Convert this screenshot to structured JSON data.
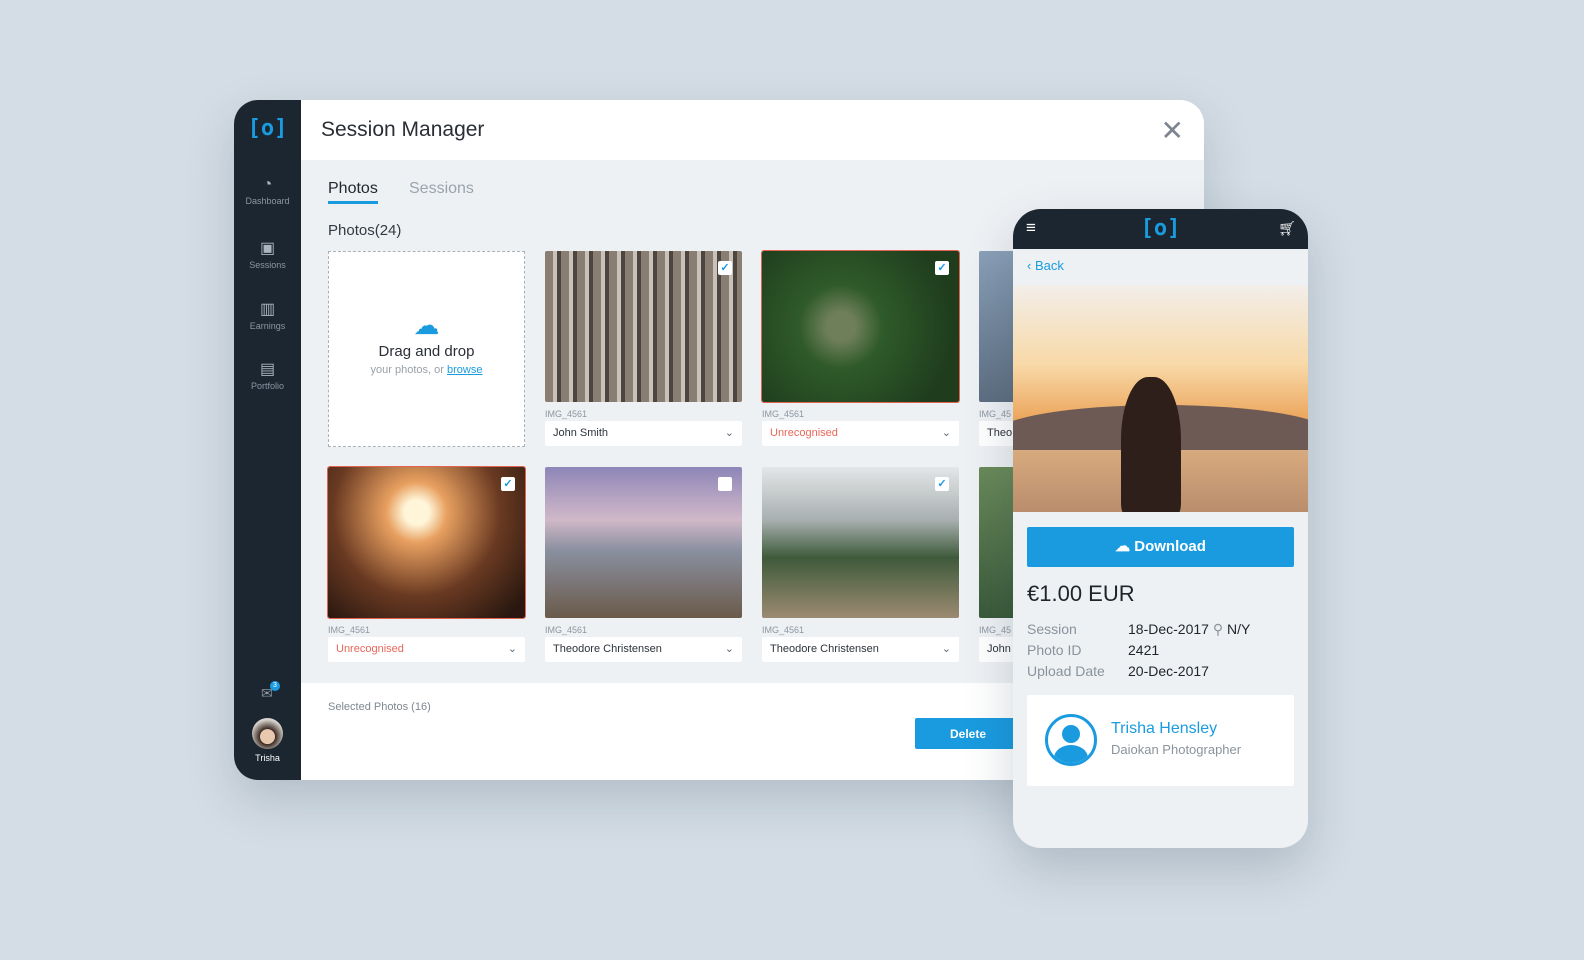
{
  "app": {
    "logo": "[o]",
    "title": "Session Manager",
    "close_icon": "close-icon"
  },
  "sidebar": {
    "items": [
      {
        "label": "Dashboard",
        "icon": "gauge-icon"
      },
      {
        "label": "Sessions",
        "icon": "camera-icon"
      },
      {
        "label": "Earnings",
        "icon": "bar-chart-icon"
      },
      {
        "label": "Portfolio",
        "icon": "briefcase-icon"
      }
    ],
    "messages_badge": "3",
    "user": "Trisha"
  },
  "tabs": [
    {
      "label": "Photos",
      "active": true
    },
    {
      "label": "Sessions",
      "active": false
    }
  ],
  "photos": {
    "heading": "Photos(24)",
    "upload": {
      "title": "Drag and drop",
      "sub": "your photos, or ",
      "link": "browse"
    },
    "items": [
      {
        "caption": "IMG_4561",
        "person": "John Smith",
        "checked": true,
        "unrecognised": false
      },
      {
        "caption": "IMG_4561",
        "person": "Unrecognised",
        "checked": true,
        "unrecognised": true
      },
      {
        "caption": "IMG_45",
        "person": "Theo",
        "checked": false,
        "unrecognised": false
      },
      {
        "caption": "IMG_4561",
        "person": "Unrecognised",
        "checked": true,
        "unrecognised": true
      },
      {
        "caption": "IMG_4561",
        "person": "Theodore Christensen",
        "checked": false,
        "unrecognised": false
      },
      {
        "caption": "IMG_4561",
        "person": "Theodore Christensen",
        "checked": true,
        "unrecognised": false
      },
      {
        "caption": "IMG_45",
        "person": "John",
        "checked": false,
        "unrecognised": false
      }
    ]
  },
  "footer": {
    "selected": "Selected Photos (16)",
    "delete": "Delete"
  },
  "mobile": {
    "logo": "[o]",
    "back": "Back",
    "download": "Download",
    "price": "€1.00 EUR",
    "details": [
      {
        "label": "Session",
        "value": "18-Dec-2017",
        "extra": "N/Y"
      },
      {
        "label": "Photo ID",
        "value": "2421"
      },
      {
        "label": "Upload Date",
        "value": "20-Dec-2017"
      }
    ],
    "photographer": {
      "name": "Trisha Hensley",
      "role": "Daiokan Photographer"
    }
  },
  "colors": {
    "accent": "#1a9be0",
    "sidebar": "#1b2631",
    "warning": "#e8665a"
  }
}
